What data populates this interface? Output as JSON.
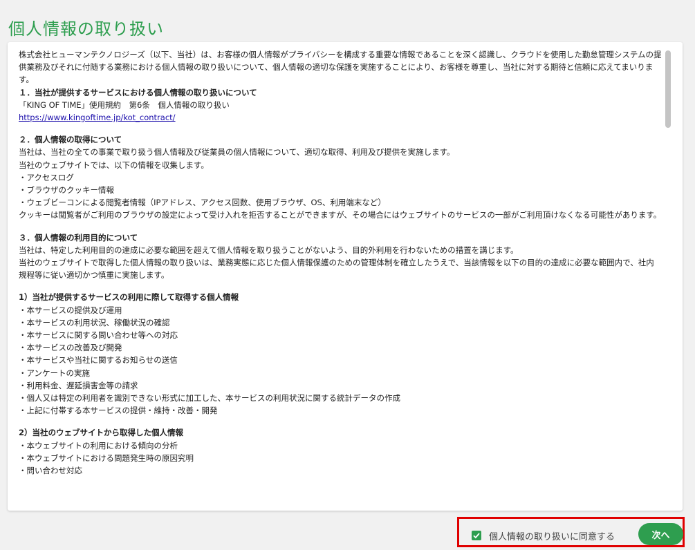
{
  "title": "個人情報の取り扱い",
  "intro": "株式会社ヒューマンテクノロジーズ（以下、当社）は、お客様の個人情報がプライバシーを構成する重要な情報であることを深く認識し、クラウドを使用した勤怠管理システムの提供業務及びそれに付随する業務における個人情報の取り扱いについて、個人情報の適切な保護を実施することにより、お客様を尊重し、当社に対する期待と信頼に応えてまいります。",
  "section1": {
    "heading": "１．当社が提供するサービスにおける個人情報の取り扱いについて",
    "text": "「KING OF TIME」使用規約　第6条　個人情報の取り扱い",
    "link": "https://www.kingoftime.jp/kot_contract/"
  },
  "section2": {
    "heading": "２．個人情報の取得について",
    "lines": [
      "当社は、当社の全ての事業で取り扱う個人情報及び従業員の個人情報について、適切な取得、利用及び提供を実施します。",
      "当社のウェブサイトでは、以下の情報を収集します。",
      "・アクセスログ",
      "・ブラウザのクッキー情報",
      "・ウェブビーコンによる閲覧者情報（IPアドレス、アクセス回数、使用ブラウザ、OS、利用端末など）",
      "クッキーは閲覧者がご利用のブラウザの設定によって受け入れを拒否することができますが、その場合にはウェブサイトのサービスの一部がご利用頂けなくなる可能性があります。"
    ]
  },
  "section3": {
    "heading": "３．個人情報の利用目的について",
    "lines": [
      "当社は、特定した利用目的の達成に必要な範囲を超えて個人情報を取り扱うことがないよう、目的外利用を行わないための措置を講じます。",
      "当社のウェブサイトで取得した個人情報の取り扱いは、業務実態に応じた個人情報保護のための管理体制を確立したうえで、当該情報を以下の目的の達成に必要な範囲内で、社内規程等に従い適切かつ慎重に実施します。"
    ]
  },
  "sub1": {
    "heading": "1）当社が提供するサービスの利用に際して取得する個人情報",
    "items": [
      "・本サービスの提供及び運用",
      "・本サービスの利用状況、稼働状況の確認",
      "・本サービスに関する問い合わせ等への対応",
      "・本サービスの改善及び開発",
      "・本サービスや当社に関するお知らせの送信",
      "・アンケートの実施",
      "・利用料金、遅延損害金等の請求",
      "・個人又は特定の利用者を識別できない形式に加工した、本サービスの利用状況に関する統計データの作成",
      "・上記に付帯する本サービスの提供・維持・改善・開発"
    ]
  },
  "sub2": {
    "heading": "2）当社のウェブサイトから取得した個人情報",
    "items": [
      "・本ウェブサイトの利用における傾向の分析",
      "・本ウェブサイトにおける問題発生時の原因究明",
      "・問い合わせ対応"
    ]
  },
  "consent": {
    "label": "個人情報の取り扱いに同意する",
    "checked": true
  },
  "next_button": "次へ",
  "colors": {
    "accent": "#2e9e4f",
    "highlight_border": "#e00000"
  }
}
